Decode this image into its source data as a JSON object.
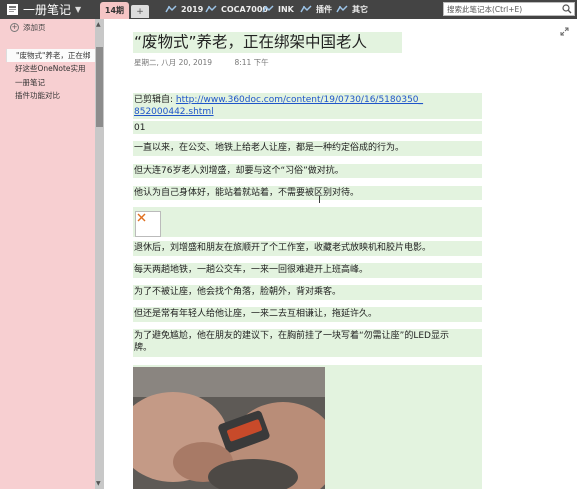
{
  "app": {
    "notebook_title": "一册笔记"
  },
  "tabs": {
    "active": "14期",
    "add": "+",
    "sections": [
      {
        "label": "2019"
      },
      {
        "label": "COCA7000"
      },
      {
        "label": "INK"
      },
      {
        "label": "插件"
      },
      {
        "label": "其它"
      }
    ]
  },
  "search": {
    "placeholder": "搜索此笔记本(Ctrl+E)"
  },
  "leftnav": {
    "add_page": "添加页",
    "pages": [
      {
        "label": "\"废物式\"养老，正在绑",
        "active": true
      },
      {
        "label": "好这些OneNote实用",
        "active": false
      },
      {
        "label": "一册笔记",
        "active": false
      },
      {
        "label": "插件功能对比",
        "active": false
      }
    ]
  },
  "page": {
    "title": "“废物式”养老，正在绑架中国老人",
    "date": "星期二, 八月 20, 2019",
    "time": "8:11 下午",
    "clip_prefix": "已剪辑自: ",
    "clip_url_line1": "http://www.360doc.com/content/19/0730/16/5180350_",
    "clip_url_line2": "852000442.shtml",
    "paragraphs": [
      "01",
      "一直以来，在公交、地铁上给老人让座，都是一种约定俗成的行为。",
      "但大连76岁老人刘增盛，却要与这个“习俗”做对抗。",
      "他认为自己身体好，能站着就站着，不需要被区别对待。",
      "退休后，刘增盛和朋友在旅顺开了个工作室，收藏老式放映机和胶片电影。",
      "每天两趟地铁，一趟公交车，一来一回很难避开上班高峰。",
      "为了不被让座，他会找个角落，脸朝外，背对乘客。",
      "但还是常有年轻人给他让座，一来二去互相谦让，拖延许久。",
      "为了避免尴尬，他在朋友的建议下，在胸前挂了一块写着“勿需让座”的LED显示",
      "牌。"
    ]
  },
  "colors": {
    "topbar": "#444444",
    "leftnav": "#f7cfd1",
    "active_tab": "#f5c5c5",
    "paragraph_bg": "#e3f3df",
    "link": "#1f55c9"
  },
  "icons": [
    "onenote-icon",
    "chevron-down-icon",
    "section-tab-icon",
    "search-icon",
    "plus-circle-icon",
    "expand-icon",
    "broken-image-icon",
    "text-cursor-icon"
  ]
}
